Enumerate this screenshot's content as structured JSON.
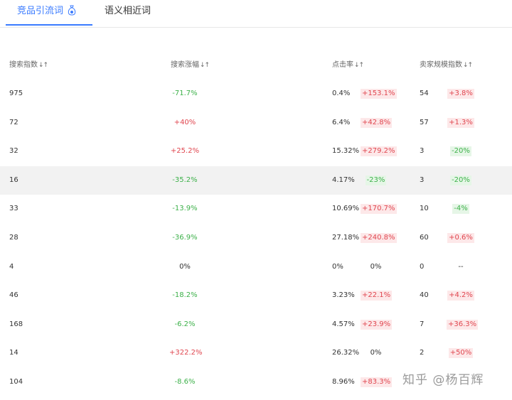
{
  "tabs": [
    {
      "label": "竞品引流词",
      "active": true
    },
    {
      "label": "语义相近词",
      "active": false
    }
  ],
  "headers": {
    "search_index": "搜索指数",
    "search_growth": "搜索涨幅",
    "ctr": "点击率",
    "seller_scale": "卖家规模指数",
    "sort_glyph": "↓↑"
  },
  "rows": [
    {
      "search_index": "975",
      "search_growth": "-71.7%",
      "growth_dir": "down",
      "ctr": "0.4%",
      "ctr_change": "+153.1%",
      "ctr_dir": "up",
      "seller_scale": "54",
      "seller_change": "+3.8%",
      "seller_dir": "up"
    },
    {
      "search_index": "72",
      "search_growth": "+40%",
      "growth_dir": "up",
      "ctr": "6.4%",
      "ctr_change": "+42.8%",
      "ctr_dir": "up",
      "seller_scale": "57",
      "seller_change": "+1.3%",
      "seller_dir": "up"
    },
    {
      "search_index": "32",
      "search_growth": "+25.2%",
      "growth_dir": "up",
      "ctr": "15.32%",
      "ctr_change": "+279.2%",
      "ctr_dir": "up",
      "seller_scale": "3",
      "seller_change": "-20%",
      "seller_dir": "down"
    },
    {
      "search_index": "16",
      "search_growth": "-35.2%",
      "growth_dir": "down",
      "ctr": "4.17%",
      "ctr_change": "-23%",
      "ctr_dir": "down",
      "seller_scale": "3",
      "seller_change": "-20%",
      "seller_dir": "down",
      "highlight": true
    },
    {
      "search_index": "33",
      "search_growth": "-13.9%",
      "growth_dir": "down",
      "ctr": "10.69%",
      "ctr_change": "+170.7%",
      "ctr_dir": "up",
      "seller_scale": "10",
      "seller_change": "-4%",
      "seller_dir": "down"
    },
    {
      "search_index": "28",
      "search_growth": "-36.9%",
      "growth_dir": "down",
      "ctr": "27.18%",
      "ctr_change": "+240.8%",
      "ctr_dir": "up",
      "seller_scale": "60",
      "seller_change": "+0.6%",
      "seller_dir": "up"
    },
    {
      "search_index": "4",
      "search_growth": "0%",
      "growth_dir": "neutral",
      "ctr": "0%",
      "ctr_change": "0%",
      "ctr_dir": "neutral",
      "seller_scale": "0",
      "seller_change": "--",
      "seller_dir": "neutral"
    },
    {
      "search_index": "46",
      "search_growth": "-18.2%",
      "growth_dir": "down",
      "ctr": "3.23%",
      "ctr_change": "+22.1%",
      "ctr_dir": "up",
      "seller_scale": "40",
      "seller_change": "+4.2%",
      "seller_dir": "up"
    },
    {
      "search_index": "168",
      "search_growth": "-6.2%",
      "growth_dir": "down",
      "ctr": "4.57%",
      "ctr_change": "+23.9%",
      "ctr_dir": "up",
      "seller_scale": "7",
      "seller_change": "+36.3%",
      "seller_dir": "up"
    },
    {
      "search_index": "14",
      "search_growth": "+322.2%",
      "growth_dir": "up",
      "ctr": "26.32%",
      "ctr_change": "0%",
      "ctr_dir": "neutral",
      "seller_scale": "2",
      "seller_change": "+50%",
      "seller_dir": "up"
    },
    {
      "search_index": "104",
      "search_growth": "-8.6%",
      "growth_dir": "down",
      "ctr": "8.96%",
      "ctr_change": "+83.3%",
      "ctr_dir": "up",
      "seller_scale": "",
      "seller_change": "",
      "seller_dir": "neutral"
    }
  ],
  "watermark": "知乎 @杨百辉",
  "colors": {
    "accent": "#3a7bff",
    "up": "#e0464f",
    "down": "#3db14a",
    "highlight_row": "#f2f2f2"
  },
  "icons": {
    "tab_icon": "money-bag-icon",
    "sort": "sort-arrows-icon"
  }
}
